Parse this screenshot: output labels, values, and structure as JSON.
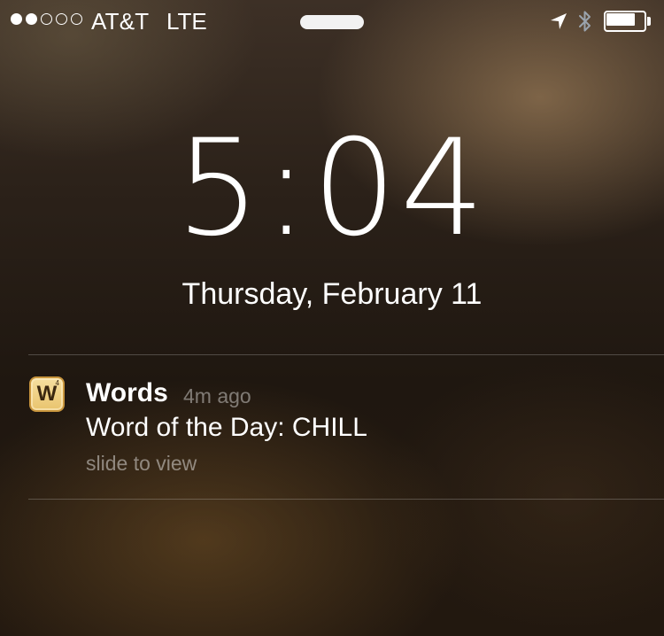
{
  "status_bar": {
    "signal_bars": {
      "filled": 2,
      "total": 5
    },
    "carrier": "AT&T",
    "network": "LTE",
    "location_icon": "location-arrow-icon",
    "bluetooth_icon": "bluetooth-icon",
    "battery_level": 0.75
  },
  "lock_screen": {
    "time": "5:04",
    "date": "Thursday, February 11"
  },
  "notification": {
    "app_icon": {
      "letter": "W",
      "score": "4"
    },
    "app_name": "Words",
    "time_ago": "4m ago",
    "message": "Word of the Day: CHILL",
    "action_hint": "slide to view"
  },
  "colors": {
    "text": "#ffffff",
    "muted_text": "#8a8078",
    "app_icon_tile": "#f0d58a"
  }
}
